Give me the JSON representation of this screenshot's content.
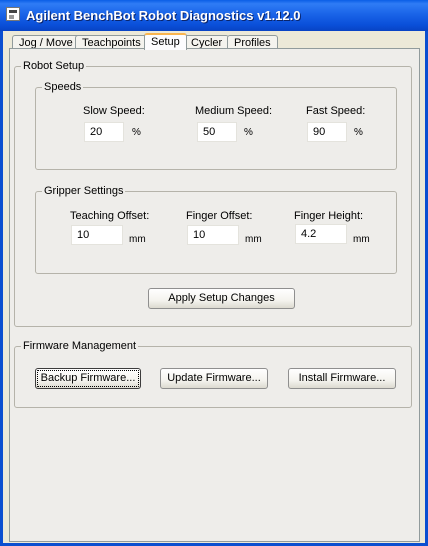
{
  "window": {
    "title": "Agilent BenchBot Robot Diagnostics v1.12.0"
  },
  "tabs": [
    {
      "label": "Jog / Move"
    },
    {
      "label": "Teachpoints"
    },
    {
      "label": "Setup"
    },
    {
      "label": "Cycler"
    },
    {
      "label": "Profiles"
    }
  ],
  "active_tab": "Setup",
  "robot_setup": {
    "title": "Robot Setup",
    "speeds": {
      "title": "Speeds",
      "slow": {
        "label": "Slow Speed:",
        "value": "20",
        "unit": "%"
      },
      "medium": {
        "label": "Medium Speed:",
        "value": "50",
        "unit": "%"
      },
      "fast": {
        "label": "Fast Speed:",
        "value": "90",
        "unit": "%"
      }
    },
    "gripper": {
      "title": "Gripper Settings",
      "teaching_offset": {
        "label": "Teaching Offset:",
        "value": "10",
        "unit": "mm"
      },
      "finger_offset": {
        "label": "Finger Offset:",
        "value": "10",
        "unit": "mm"
      },
      "finger_height": {
        "label": "Finger Height:",
        "value": "4.2",
        "unit": "mm"
      }
    },
    "apply_label": "Apply Setup Changes"
  },
  "firmware": {
    "title": "Firmware Management",
    "backup_label": "Backup Firmware...",
    "update_label": "Update Firmware...",
    "install_label": "Install Firmware..."
  }
}
